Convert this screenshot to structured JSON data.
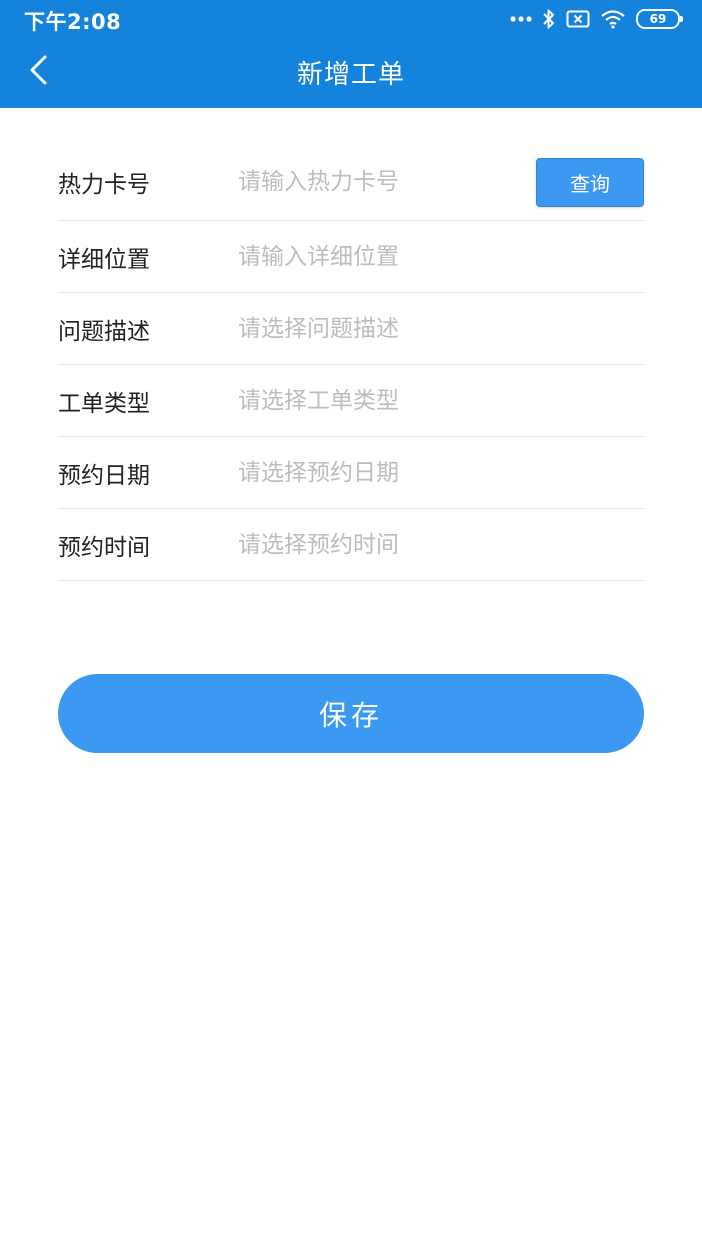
{
  "status": {
    "time": "下午2:08",
    "battery": "69",
    "icons": [
      "more-dots-icon",
      "bluetooth-icon",
      "sim-x-icon",
      "wifi-icon",
      "battery-icon"
    ]
  },
  "appbar": {
    "title": "新增工单",
    "back_icon": "chevron-left-icon"
  },
  "form": {
    "rows": [
      {
        "label": "热力卡号",
        "placeholder": "请输入热力卡号",
        "value": ""
      },
      {
        "label": "详细位置",
        "placeholder": "请输入详细位置",
        "value": ""
      },
      {
        "label": "问题描述",
        "placeholder": "请选择问题描述",
        "value": ""
      },
      {
        "label": "工单类型",
        "placeholder": "请选择工单类型",
        "value": ""
      },
      {
        "label": "预约日期",
        "placeholder": "请选择预约日期",
        "value": ""
      },
      {
        "label": "预约时间",
        "placeholder": "请选择预约时间",
        "value": ""
      }
    ],
    "query_label": "查询",
    "save_label": "保存"
  },
  "colors": {
    "primary": "#1483db",
    "button": "#3b99f2",
    "placeholder": "#bdbdbd",
    "divider": "#e6e6e6"
  }
}
